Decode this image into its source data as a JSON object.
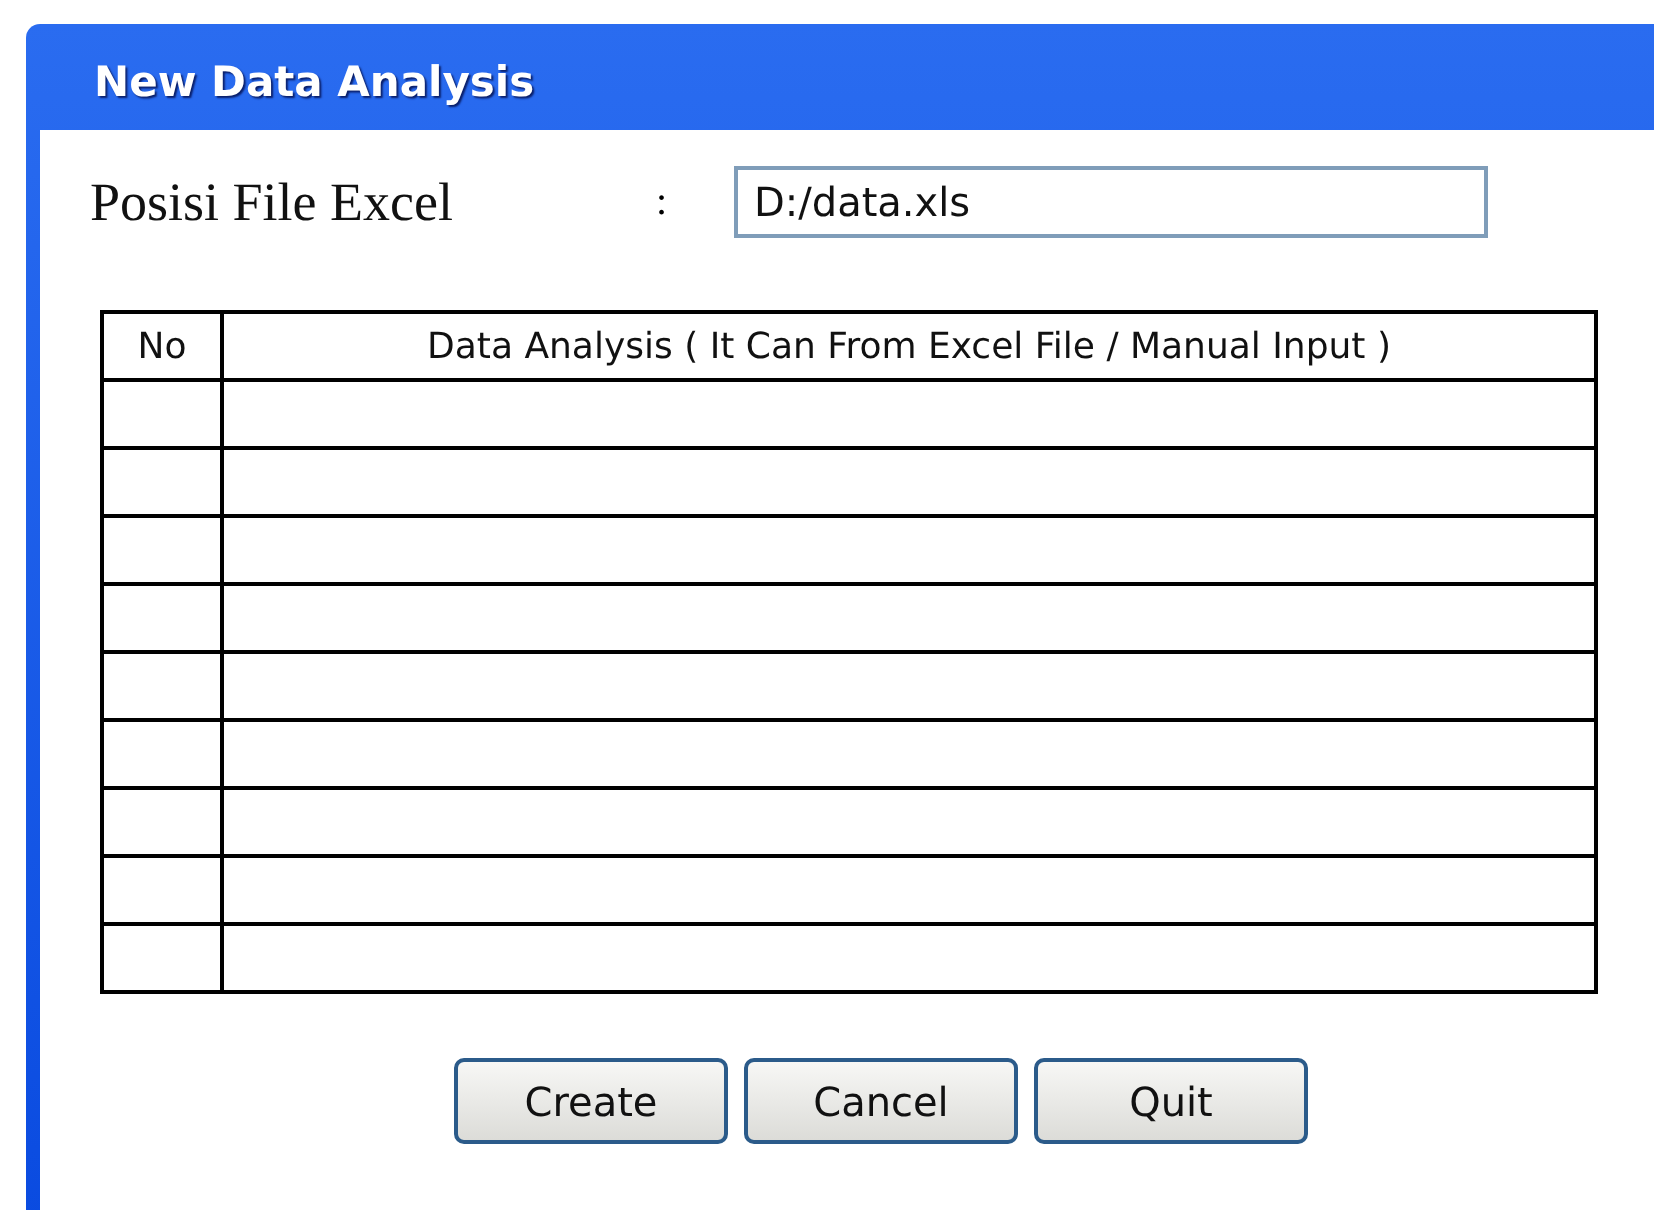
{
  "window": {
    "title": "New Data Analysis"
  },
  "file_field": {
    "label": "Posisi File Excel",
    "separator": ":",
    "value": "D:/data.xls"
  },
  "table": {
    "columns": [
      "No",
      "Data Analysis ( It Can From Excel File / Manual Input )"
    ],
    "rows": [
      {},
      {},
      {},
      {},
      {},
      {},
      {},
      {},
      {}
    ]
  },
  "buttons": [
    "Create",
    "Cancel",
    "Quit"
  ]
}
